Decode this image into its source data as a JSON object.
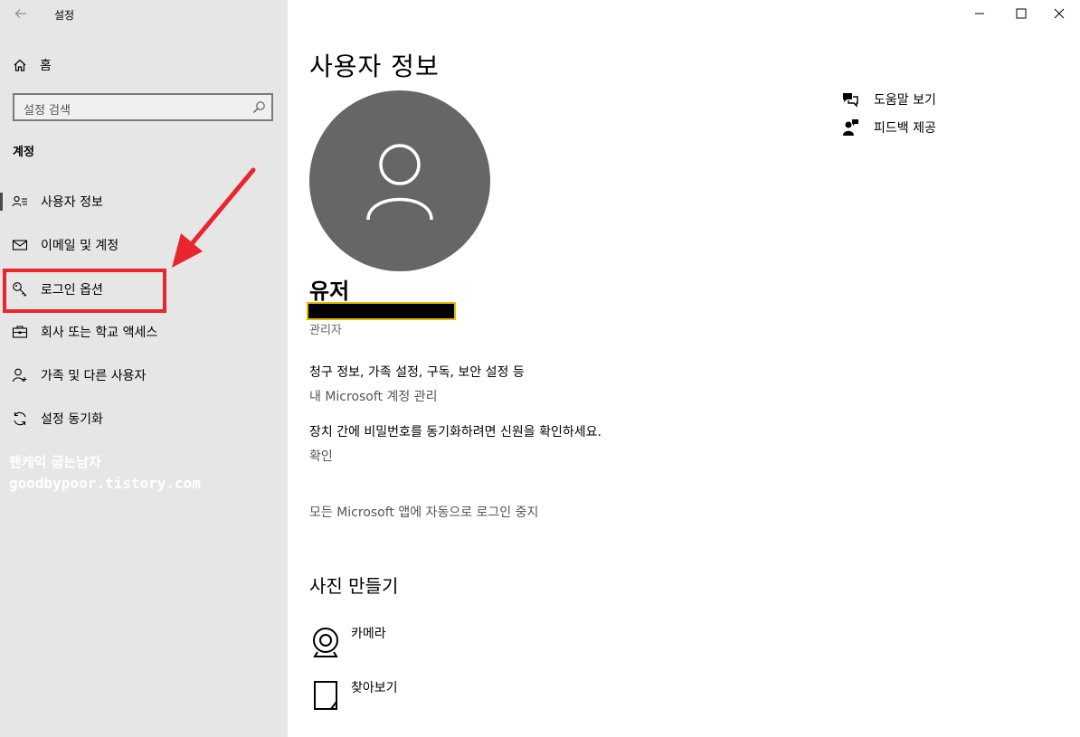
{
  "window": {
    "app_title": "설정"
  },
  "sidebar": {
    "home_label": "홈",
    "search_placeholder": "설정 검색",
    "section_label": "계정",
    "items": [
      {
        "label": "사용자 정보",
        "icon": "user-card-icon"
      },
      {
        "label": "이메일 및 계정",
        "icon": "mail-icon"
      },
      {
        "label": "로그인 옵션",
        "icon": "key-icon"
      },
      {
        "label": "회사 또는 학교 액세스",
        "icon": "briefcase-icon"
      },
      {
        "label": "가족 및 다른 사용자",
        "icon": "person-add-icon"
      },
      {
        "label": "설정 동기화",
        "icon": "sync-icon"
      }
    ],
    "selected_index": 0,
    "annotation_color": "#e8262d"
  },
  "watermark": {
    "line1": "팬케익 굽는남자",
    "line2": "goodbypoor.tistory.com"
  },
  "main": {
    "title": "사용자 정보",
    "user_name": "유저",
    "role": "관리자",
    "billing_text": "청구 정보, 가족 설정, 구독, 보안 설정 등",
    "manage_link": "내 Microsoft 계정 관리",
    "verify_text": "장치 간에 비밀번호를 동기화하려면 신원을 확인하세요.",
    "verify_link": "확인",
    "stop_signin_link": "모든 Microsoft 앱에 자동으로 로그인 중지",
    "photo_section_title": "사진 만들기",
    "camera_label": "카메라",
    "browse_label": "찾아보기"
  },
  "help": {
    "help_label": "도움말 보기",
    "feedback_label": "피드백 제공"
  },
  "colors": {
    "sidebar_bg": "#e6e6e6",
    "avatar_bg": "#666666",
    "link_gray": "#555555"
  }
}
